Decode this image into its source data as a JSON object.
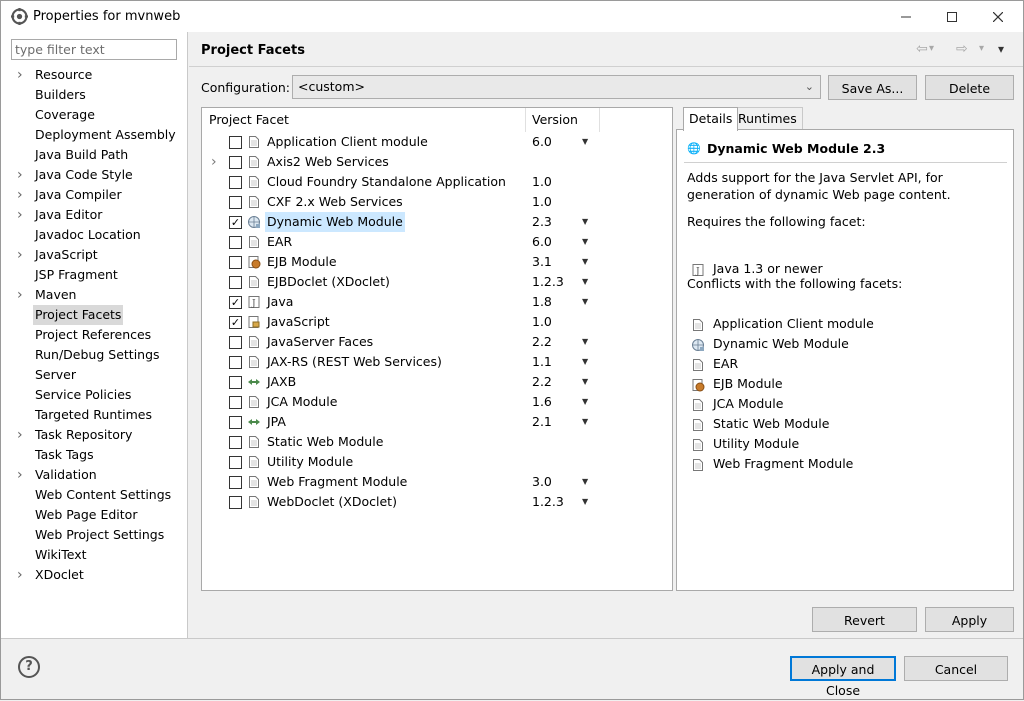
{
  "window": {
    "title": "Properties for mvnweb"
  },
  "window_controls": {
    "minimize": "–",
    "maximize": "☐",
    "close": "✕"
  },
  "filter": {
    "placeholder": "type filter text"
  },
  "nav": [
    {
      "label": "Resource",
      "expandable": true
    },
    {
      "label": "Builders",
      "expandable": false
    },
    {
      "label": "Coverage",
      "expandable": false
    },
    {
      "label": "Deployment Assembly",
      "expandable": false
    },
    {
      "label": "Java Build Path",
      "expandable": false
    },
    {
      "label": "Java Code Style",
      "expandable": true
    },
    {
      "label": "Java Compiler",
      "expandable": true
    },
    {
      "label": "Java Editor",
      "expandable": true
    },
    {
      "label": "Javadoc Location",
      "expandable": false
    },
    {
      "label": "JavaScript",
      "expandable": true
    },
    {
      "label": "JSP Fragment",
      "expandable": false
    },
    {
      "label": "Maven",
      "expandable": true
    },
    {
      "label": "Project Facets",
      "expandable": false,
      "selected": true
    },
    {
      "label": "Project References",
      "expandable": false
    },
    {
      "label": "Run/Debug Settings",
      "expandable": false
    },
    {
      "label": "Server",
      "expandable": false
    },
    {
      "label": "Service Policies",
      "expandable": false
    },
    {
      "label": "Targeted Runtimes",
      "expandable": false
    },
    {
      "label": "Task Repository",
      "expandable": true
    },
    {
      "label": "Task Tags",
      "expandable": false
    },
    {
      "label": "Validation",
      "expandable": true
    },
    {
      "label": "Web Content Settings",
      "expandable": false
    },
    {
      "label": "Web Page Editor",
      "expandable": false
    },
    {
      "label": "Web Project Settings",
      "expandable": false
    },
    {
      "label": "WikiText",
      "expandable": false
    },
    {
      "label": "XDoclet",
      "expandable": true
    }
  ],
  "page": {
    "title": "Project Facets"
  },
  "toolbar": {
    "back": "⇦",
    "forward": "⇨",
    "menu": "▾"
  },
  "configuration": {
    "label": "Configuration:",
    "value": "<custom>",
    "save_as": "Save As...",
    "delete": "Delete"
  },
  "facets": {
    "col_facet": "Project Facet",
    "col_version": "Version",
    "rows": [
      {
        "name": "Application Client module",
        "version": "6.0",
        "checked": false,
        "dropdown": true,
        "icon": "page-icon",
        "expandable": false
      },
      {
        "name": "Axis2 Web Services",
        "version": "",
        "checked": false,
        "dropdown": false,
        "icon": "page-icon",
        "expandable": true
      },
      {
        "name": "Cloud Foundry Standalone Application",
        "version": "1.0",
        "checked": false,
        "dropdown": false,
        "icon": "page-icon",
        "expandable": false
      },
      {
        "name": "CXF 2.x Web Services",
        "version": "1.0",
        "checked": false,
        "dropdown": false,
        "icon": "page-icon",
        "expandable": false
      },
      {
        "name": "Dynamic Web Module",
        "version": "2.3",
        "checked": true,
        "dropdown": true,
        "icon": "globe-icon",
        "expandable": false,
        "selected": true
      },
      {
        "name": "EAR",
        "version": "6.0",
        "checked": false,
        "dropdown": true,
        "icon": "page-icon",
        "expandable": false
      },
      {
        "name": "EJB Module",
        "version": "3.1",
        "checked": false,
        "dropdown": true,
        "icon": "bean-icon",
        "expandable": false
      },
      {
        "name": "EJBDoclet (XDoclet)",
        "version": "1.2.3",
        "checked": false,
        "dropdown": true,
        "icon": "page-icon",
        "expandable": false
      },
      {
        "name": "Java",
        "version": "1.8",
        "checked": true,
        "dropdown": true,
        "icon": "java-icon",
        "expandable": false
      },
      {
        "name": "JavaScript",
        "version": "1.0",
        "checked": true,
        "dropdown": false,
        "icon": "lock-page-icon",
        "expandable": false
      },
      {
        "name": "JavaServer Faces",
        "version": "2.2",
        "checked": false,
        "dropdown": true,
        "icon": "page-icon",
        "expandable": false
      },
      {
        "name": "JAX-RS (REST Web Services)",
        "version": "1.1",
        "checked": false,
        "dropdown": true,
        "icon": "page-icon",
        "expandable": false
      },
      {
        "name": "JAXB",
        "version": "2.2",
        "checked": false,
        "dropdown": true,
        "icon": "arrows-icon",
        "expandable": false
      },
      {
        "name": "JCA Module",
        "version": "1.6",
        "checked": false,
        "dropdown": true,
        "icon": "page-icon",
        "expandable": false
      },
      {
        "name": "JPA",
        "version": "2.1",
        "checked": false,
        "dropdown": true,
        "icon": "arrows-icon",
        "expandable": false
      },
      {
        "name": "Static Web Module",
        "version": "",
        "checked": false,
        "dropdown": false,
        "icon": "page-icon",
        "expandable": false
      },
      {
        "name": "Utility Module",
        "version": "",
        "checked": false,
        "dropdown": false,
        "icon": "page-icon",
        "expandable": false
      },
      {
        "name": "Web Fragment Module",
        "version": "3.0",
        "checked": false,
        "dropdown": true,
        "icon": "page-icon",
        "expandable": false
      },
      {
        "name": "WebDoclet (XDoclet)",
        "version": "1.2.3",
        "checked": false,
        "dropdown": true,
        "icon": "page-icon",
        "expandable": false
      }
    ]
  },
  "details": {
    "tab_details": "Details",
    "tab_runtimes": "Runtimes",
    "title": "Dynamic Web Module 2.3",
    "description": [
      "Adds support for the Java Servlet API, for",
      "generation of dynamic Web page content."
    ],
    "requires_label": "Requires the following facet:",
    "requires": [
      {
        "name": "Java 1.3 or newer",
        "icon": "java-icon"
      }
    ],
    "conflicts_label": "Conflicts with the following facets:",
    "conflicts": [
      {
        "name": "Application Client module",
        "icon": "page-icon"
      },
      {
        "name": "Dynamic Web Module",
        "icon": "globe-icon"
      },
      {
        "name": "EAR",
        "icon": "page-icon"
      },
      {
        "name": "EJB Module",
        "icon": "bean-icon"
      },
      {
        "name": "JCA Module",
        "icon": "page-icon"
      },
      {
        "name": "Static Web Module",
        "icon": "page-icon"
      },
      {
        "name": "Utility Module",
        "icon": "page-icon"
      },
      {
        "name": "Web Fragment Module",
        "icon": "page-icon"
      }
    ]
  },
  "buttons": {
    "revert": "Revert",
    "apply": "Apply",
    "apply_close": "Apply and Close",
    "cancel": "Cancel"
  },
  "colors": {
    "selection": "#cce8ff",
    "primary_border": "#0078d7",
    "nav_selected": "#d9d9d9"
  }
}
